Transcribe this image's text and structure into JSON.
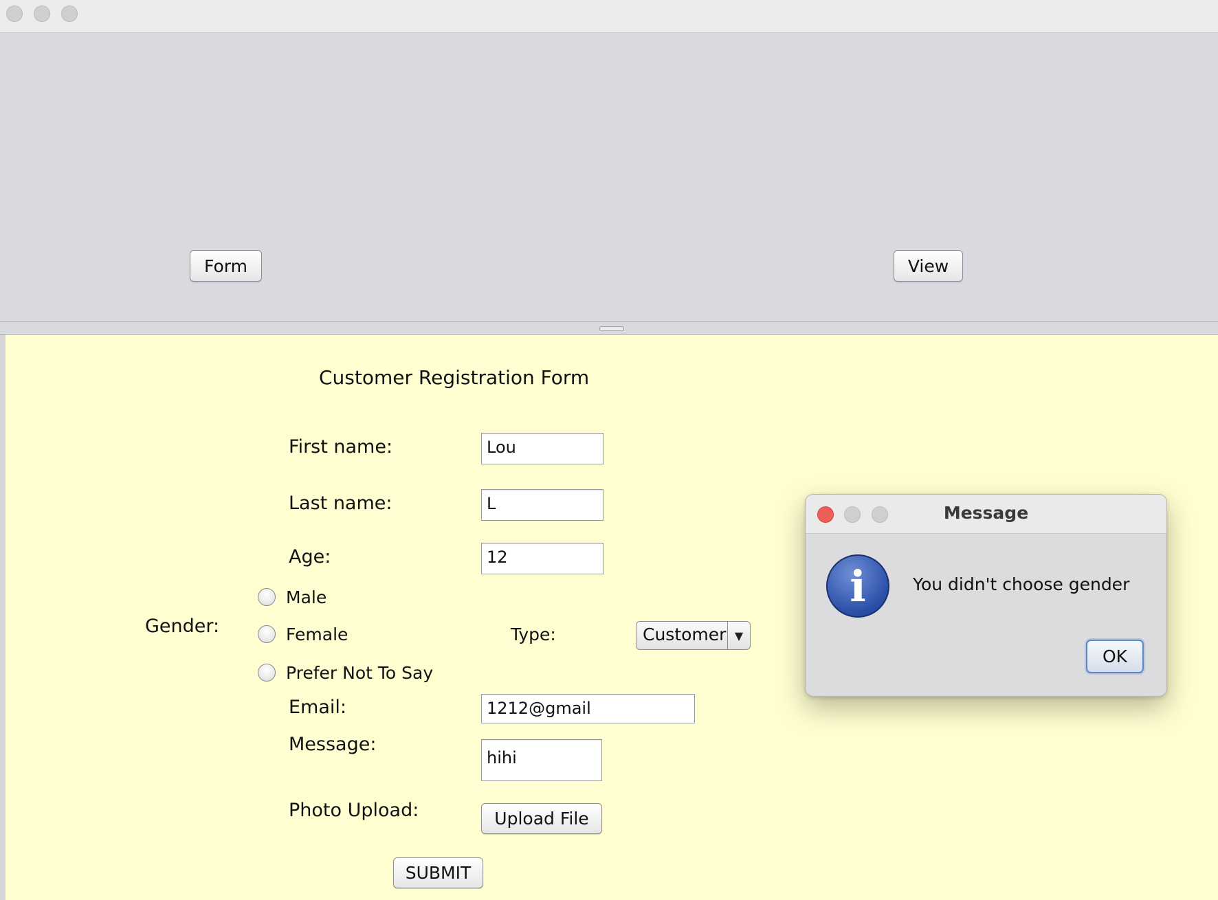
{
  "window": {
    "traffic_lights": [
      "close",
      "minimize",
      "zoom"
    ]
  },
  "top_panel": {
    "form_button": "Form",
    "view_button": "View"
  },
  "form": {
    "title": "Customer Registration Form",
    "first_name_label": "First name:",
    "first_name_value": "Lou",
    "last_name_label": "Last name:",
    "last_name_value": "L",
    "age_label": "Age:",
    "age_value": "12",
    "gender_label": "Gender:",
    "gender_options": [
      "Male",
      "Female",
      "Prefer Not To Say"
    ],
    "type_label": "Type:",
    "type_selected": "Customer",
    "email_label": "Email:",
    "email_value": "1212@gmail",
    "message_label": "Message:",
    "message_value": "hihi",
    "photo_label": "Photo Upload:",
    "upload_button": "Upload File",
    "submit_button": "SUBMIT"
  },
  "dialog": {
    "title": "Message",
    "icon": "info-icon",
    "icon_glyph": "i",
    "message": "You didn't choose gender",
    "ok_button": "OK",
    "close_color": "#ec5f57"
  }
}
